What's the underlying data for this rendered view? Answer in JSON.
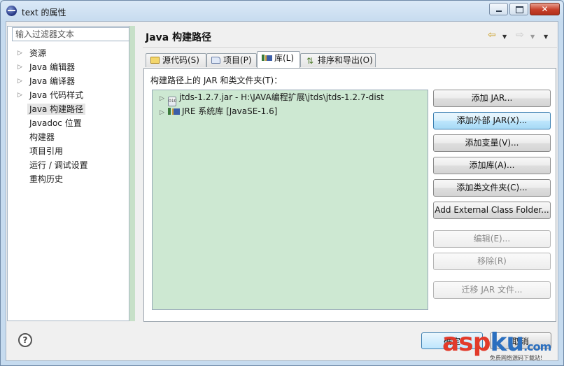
{
  "window": {
    "title": "text 的属性",
    "close_glyph": "✕"
  },
  "filter": {
    "placeholder": "输入过滤器文本"
  },
  "nav": {
    "items": [
      {
        "label": "资源",
        "expandable": true
      },
      {
        "label": "Java 编辑器",
        "expandable": true
      },
      {
        "label": "Java 编译器",
        "expandable": true
      },
      {
        "label": "Java 代码样式",
        "expandable": true
      },
      {
        "label": "Java 构建路径",
        "expandable": false,
        "selected": true
      },
      {
        "label": "Javadoc 位置",
        "expandable": false
      },
      {
        "label": "构建器",
        "expandable": false
      },
      {
        "label": "项目引用",
        "expandable": false
      },
      {
        "label": "运行 / 调试设置",
        "expandable": false
      },
      {
        "label": "重构历史",
        "expandable": false
      }
    ]
  },
  "page": {
    "title": "Java 构建路径"
  },
  "tabs": [
    {
      "label": "源代码(S)",
      "icon": "source-folder-icon"
    },
    {
      "label": "项目(P)",
      "icon": "project-icon"
    },
    {
      "label": "库(L)",
      "icon": "library-icon",
      "active": true
    },
    {
      "label": "排序和导出(O)",
      "icon": "order-export-icon"
    }
  ],
  "libraries": {
    "caption": "构建路径上的 JAR 和类文件夹(T)：",
    "entries": [
      {
        "label": "jtds-1.2.7.jar - H:\\JAVA编程扩展\\jtds\\jtds-1.2.7-dist",
        "icon": "jar-file-icon",
        "icon_text": "010"
      },
      {
        "label": "JRE 系统库 [JavaSE-1.6]",
        "icon": "jre-library-icon"
      }
    ]
  },
  "buttons": {
    "add_jar": "添加 JAR...",
    "add_external_jar": "添加外部 JAR(X)...",
    "add_variable": "添加变量(V)...",
    "add_library": "添加库(A)...",
    "add_class_folder": "添加类文件夹(C)...",
    "add_external_class_folder": "Add External Class Folder...",
    "edit": "编辑(E)...",
    "remove": "移除(R)",
    "migrate_jar": "迁移 JAR 文件..."
  },
  "footer": {
    "help": "?",
    "ok": "确定",
    "cancel": "取消"
  },
  "watermark": {
    "brand_a": "asp",
    "brand_b": "ku",
    "brand_c": ".com",
    "tagline": "免费网络源码下载站!"
  },
  "colors": {
    "list_background": "#cde8d2",
    "hot_button": "#bee6fd",
    "watermark_red": "#e23a2a",
    "watermark_blue": "#2b6fbf"
  }
}
